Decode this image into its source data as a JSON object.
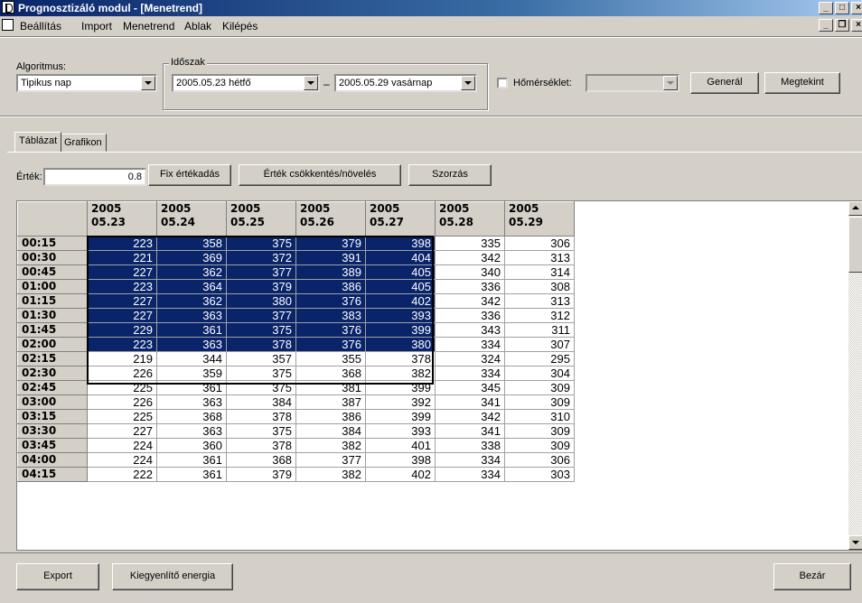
{
  "window": {
    "title": "Prognosztizáló modul - [Menetrend]"
  },
  "menu": {
    "items": [
      {
        "label": "Beállítás"
      },
      {
        "label": "Import"
      },
      {
        "label": "Menetrend"
      },
      {
        "label": "Ablak"
      },
      {
        "label": "Kilépés"
      }
    ]
  },
  "toolbar": {
    "algorithm_label": "Algoritmus:",
    "algorithm_value": "Tipikus nap",
    "period_label": "Időszak",
    "period_from": "2005.05.23   hétfő",
    "period_dash": "–",
    "period_to": "2005.05.29 vasárnap",
    "temperature_label": "Hőmérséklet:",
    "temperature_value": "",
    "temperature_checked": false,
    "generate_label": "Generál",
    "view_label": "Megtekint"
  },
  "tabs": [
    {
      "label": "Táblázat",
      "active": true
    },
    {
      "label": "Grafikon",
      "active": false
    }
  ],
  "value_row": {
    "label": "Érték:",
    "value": "0.8",
    "fix_label": "Fix értékadás",
    "adjust_label": "Érték csökkentés/növelés",
    "multiply_label": "Szorzás"
  },
  "table": {
    "columns": [
      {
        "year": "2005",
        "day": "05.23"
      },
      {
        "year": "2005",
        "day": "05.24"
      },
      {
        "year": "2005",
        "day": "05.25"
      },
      {
        "year": "2005",
        "day": "05.26"
      },
      {
        "year": "2005",
        "day": "05.27"
      },
      {
        "year": "2005",
        "day": "05.28"
      },
      {
        "year": "2005",
        "day": "05.29"
      }
    ],
    "rows": [
      {
        "time": "00:15",
        "values": [
          223,
          358,
          375,
          379,
          398,
          335,
          306
        ]
      },
      {
        "time": "00:30",
        "values": [
          221,
          369,
          372,
          391,
          404,
          342,
          313
        ]
      },
      {
        "time": "00:45",
        "values": [
          227,
          362,
          377,
          389,
          405,
          340,
          314
        ]
      },
      {
        "time": "01:00",
        "values": [
          223,
          364,
          379,
          386,
          405,
          336,
          308
        ]
      },
      {
        "time": "01:15",
        "values": [
          227,
          362,
          380,
          376,
          402,
          342,
          313
        ]
      },
      {
        "time": "01:30",
        "values": [
          227,
          363,
          377,
          383,
          393,
          336,
          312
        ]
      },
      {
        "time": "01:45",
        "values": [
          229,
          361,
          375,
          376,
          399,
          343,
          311
        ]
      },
      {
        "time": "02:00",
        "values": [
          223,
          363,
          378,
          376,
          380,
          334,
          307
        ]
      },
      {
        "time": "02:15",
        "values": [
          219,
          344,
          357,
          355,
          378,
          324,
          295
        ]
      },
      {
        "time": "02:30",
        "values": [
          226,
          359,
          375,
          368,
          382,
          334,
          304
        ]
      },
      {
        "time": "02:45",
        "values": [
          225,
          361,
          375,
          381,
          399,
          345,
          309
        ]
      },
      {
        "time": "03:00",
        "values": [
          226,
          363,
          384,
          387,
          392,
          341,
          309
        ]
      },
      {
        "time": "03:15",
        "values": [
          225,
          368,
          378,
          386,
          399,
          342,
          310
        ]
      },
      {
        "time": "03:30",
        "values": [
          227,
          363,
          375,
          384,
          393,
          341,
          309
        ]
      },
      {
        "time": "03:45",
        "values": [
          224,
          360,
          378,
          382,
          401,
          338,
          309
        ]
      },
      {
        "time": "04:00",
        "values": [
          224,
          361,
          368,
          377,
          398,
          334,
          306
        ]
      },
      {
        "time": "04:15",
        "values": [
          222,
          361,
          379,
          382,
          402,
          334,
          303
        ]
      }
    ],
    "selection": {
      "row_start": 0,
      "row_end": 7,
      "col_start": 0,
      "col_end": 4
    }
  },
  "footer": {
    "export_label": "Export",
    "balancing_label": "Kiegyenlítő energia",
    "close_label": "Bezár"
  },
  "colors": {
    "selection": "#0a246a",
    "title_bar": "#0a246a",
    "window_bg": "#d4d0c8"
  }
}
